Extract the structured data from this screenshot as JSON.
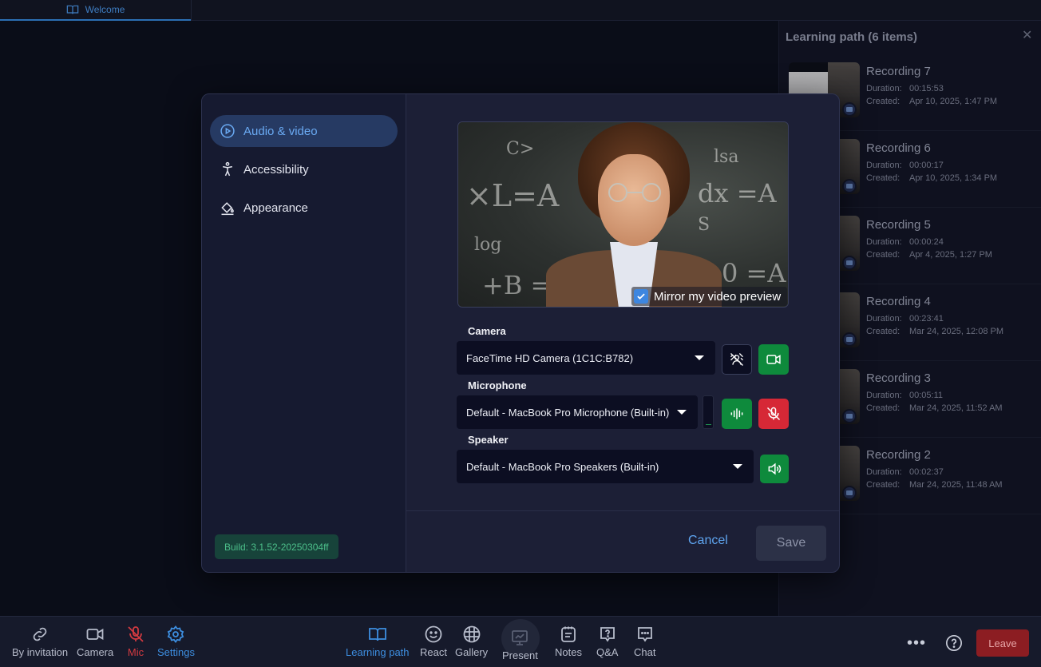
{
  "top_tab": {
    "label": "Welcome"
  },
  "learning_path": {
    "title": "Learning path (6 items)",
    "duration_label": "Duration:",
    "created_label": "Created:",
    "items": [
      {
        "title": "Recording 7",
        "duration": "00:15:53",
        "created": "Apr 10, 2025, 1:47 PM"
      },
      {
        "title": "Recording 6",
        "duration": "00:00:17",
        "created": "Apr 10, 2025, 1:34 PM"
      },
      {
        "title": "Recording 5",
        "duration": "00:00:24",
        "created": "Apr 4, 2025, 1:27 PM"
      },
      {
        "title": "Recording 4",
        "duration": "00:23:41",
        "created": "Mar 24, 2025, 12:08 PM"
      },
      {
        "title": "Recording 3",
        "duration": "00:05:11",
        "created": "Mar 24, 2025, 11:52 AM"
      },
      {
        "title": "Recording 2",
        "duration": "00:02:37",
        "created": "Mar 24, 2025, 11:48 AM"
      }
    ]
  },
  "settings": {
    "nav": [
      {
        "label": "Audio & video",
        "icon": "play-circle-icon",
        "active": true
      },
      {
        "label": "Accessibility",
        "icon": "accessibility-icon",
        "active": false
      },
      {
        "label": "Appearance",
        "icon": "paint-bucket-icon",
        "active": false
      }
    ],
    "build": "Build: 3.1.52-20250304ff",
    "mirror_label": "Mirror my video preview",
    "mirror_checked": true,
    "camera_label": "Camera",
    "camera_value": "FaceTime HD Camera (1C1C:B782)",
    "microphone_label": "Microphone",
    "microphone_value": "Default - MacBook Pro Microphone (Built-in)",
    "speaker_label": "Speaker",
    "speaker_value": "Default - MacBook Pro Speakers (Built-in)",
    "cancel": "Cancel",
    "save": "Save"
  },
  "toolbar": {
    "by_invitation": "By invitation",
    "camera": "Camera",
    "mic": "Mic",
    "settings": "Settings",
    "learning_path": "Learning path",
    "react": "React",
    "gallery": "Gallery",
    "present": "Present",
    "notes": "Notes",
    "qa": "Q&A",
    "chat": "Chat",
    "leave": "Leave"
  },
  "colors": {
    "accent": "#3d8ee0",
    "success": "#0e8a3c",
    "danger": "#d62836",
    "leave": "#8c1d22"
  }
}
